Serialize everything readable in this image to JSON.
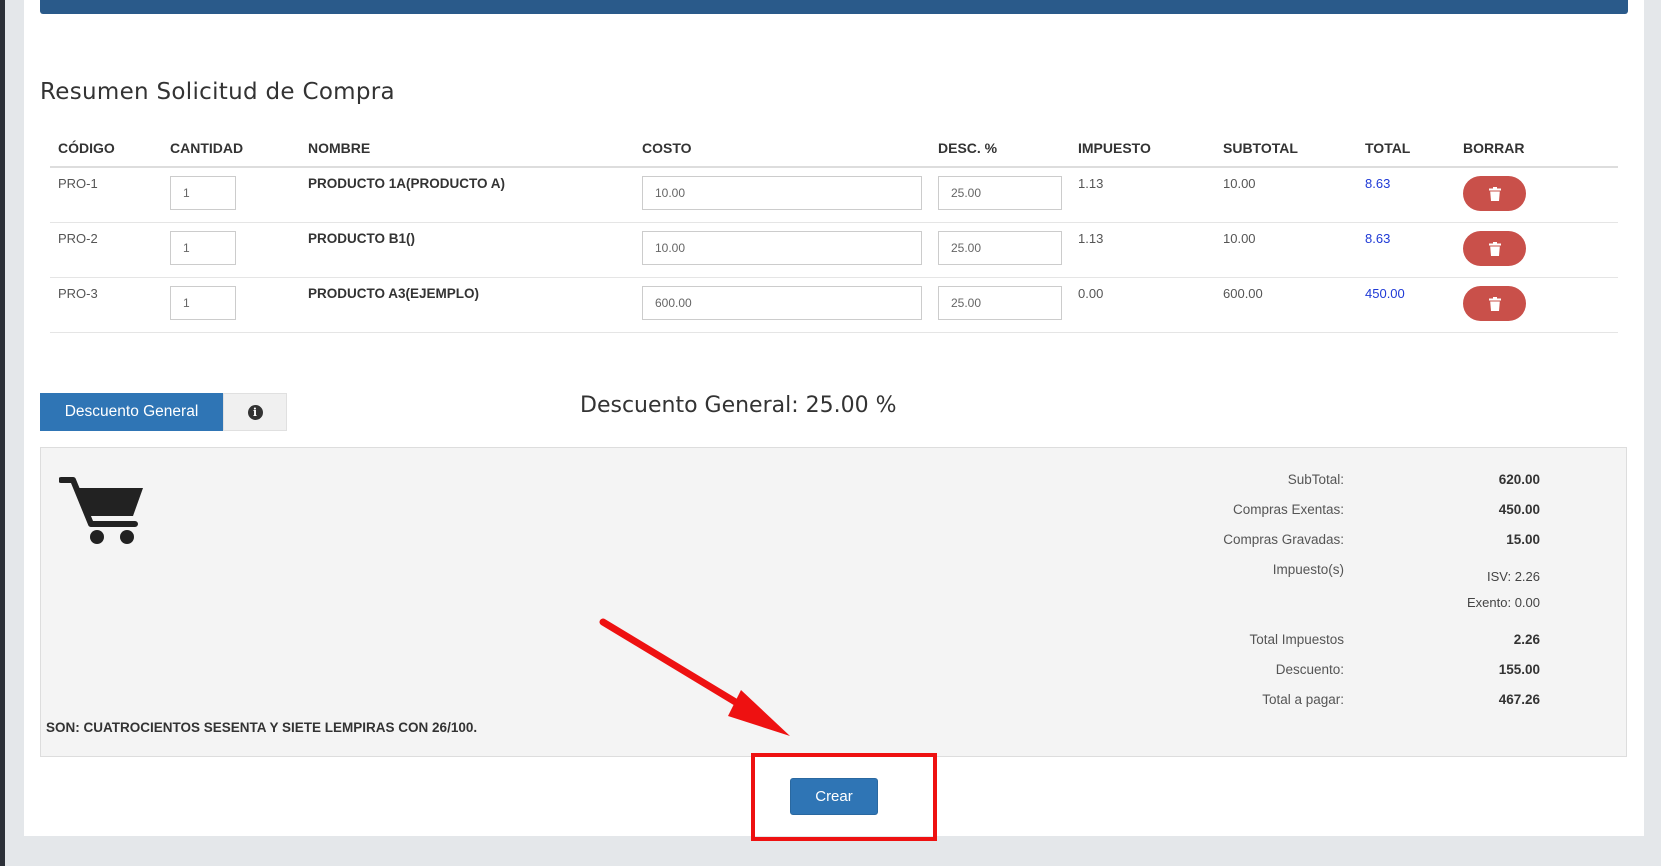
{
  "page": {
    "title": "Resumen Solicitud de Compra"
  },
  "table": {
    "headers": [
      "CÓDIGO",
      "CANTIDAD",
      "NOMBRE",
      "COSTO",
      "DESC. %",
      "IMPUESTO",
      "SUBTOTAL",
      "TOTAL",
      "BORRAR"
    ],
    "rows": [
      {
        "codigo": "PRO-1",
        "cantidad": "1",
        "nombre": "PRODUCTO 1A(PRODUCTO A)",
        "costo": "10.00",
        "desc": "25.00",
        "impuesto": "1.13",
        "subtotal": "10.00",
        "total": "8.63"
      },
      {
        "codigo": "PRO-2",
        "cantidad": "1",
        "nombre": "PRODUCTO B1()",
        "costo": "10.00",
        "desc": "25.00",
        "impuesto": "1.13",
        "subtotal": "10.00",
        "total": "8.63"
      },
      {
        "codigo": "PRO-3",
        "cantidad": "1",
        "nombre": "PRODUCTO A3(EJEMPLO)",
        "costo": "600.00",
        "desc": "25.00",
        "impuesto": "0.00",
        "subtotal": "600.00",
        "total": "450.00"
      }
    ],
    "delete_icon": "trash-icon"
  },
  "discount": {
    "button_label": "Descuento General",
    "info_icon": "info-circle-icon",
    "info_glyph": "i",
    "display": "Descuento General: 25.00 %"
  },
  "summary": {
    "cart_icon": "shopping-cart-icon",
    "subtotal_label": "SubTotal:",
    "subtotal_value": "620.00",
    "exentas_label": "Compras Exentas:",
    "exentas_value": "450.00",
    "gravadas_label": "Compras Gravadas:",
    "gravadas_value": "15.00",
    "impuestos_label": "Impuesto(s)",
    "isv": "ISV: 2.26",
    "exento": "Exento: 0.00",
    "total_impuestos_label": "Total Impuestos",
    "total_impuestos_value": "2.26",
    "descuento_label": "Descuento:",
    "descuento_value": "155.00",
    "total_pagar_label": "Total a pagar:",
    "total_pagar_value": "467.26",
    "son": "SON: CUATROCIENTOS SESENTA Y SIETE LEMPIRAS CON 26/100."
  },
  "actions": {
    "crear_label": "Crear"
  },
  "colors": {
    "primary": "#2f75b5",
    "danger": "#c9504a",
    "link": "#1f3ad6",
    "annotation": "#ee1111"
  }
}
